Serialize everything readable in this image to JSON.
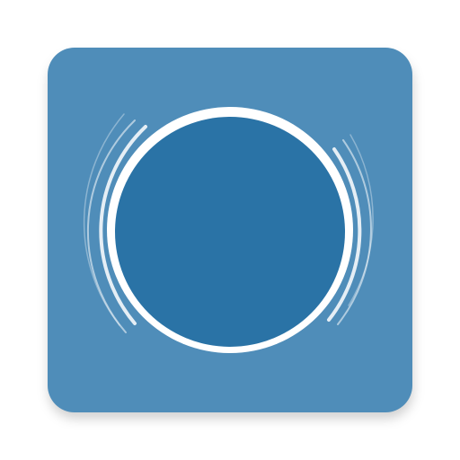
{
  "icon": {
    "name": "app-icon-circle-with-sound-waves",
    "colors": {
      "tile": "#4f8db9",
      "disc": "#2a73a6",
      "ring": "#ffffff",
      "waves": "#ffffff"
    }
  }
}
